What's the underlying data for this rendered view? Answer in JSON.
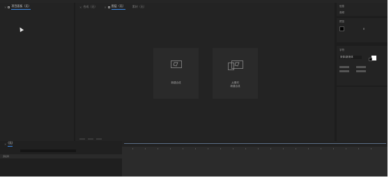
{
  "project": {
    "tab": "项目面板（无）"
  },
  "viewer": {
    "tabs": [
      {
        "label": "合成（无）",
        "active": false
      },
      {
        "label": "图层（无）",
        "active": true
      },
      {
        "label": "素材（无）",
        "active": false
      }
    ],
    "cards": {
      "new_comp": "新建合成",
      "from_footage_line1": "从素材",
      "from_footage_line2": "新建合成"
    }
  },
  "right": {
    "info": {
      "title": "信息",
      "subtitle": "音频"
    },
    "audio_title": "预览",
    "character": {
      "title": "字符",
      "font": "宋体/新宋体"
    }
  },
  "timeline": {
    "tab": "(无)",
    "column": "源名称"
  },
  "colors": {
    "accent": "#3a89e6"
  },
  "icons": [
    "lock-icon",
    "close-icon",
    "composition-icon",
    "footage-icon",
    "cursor-icon"
  ]
}
